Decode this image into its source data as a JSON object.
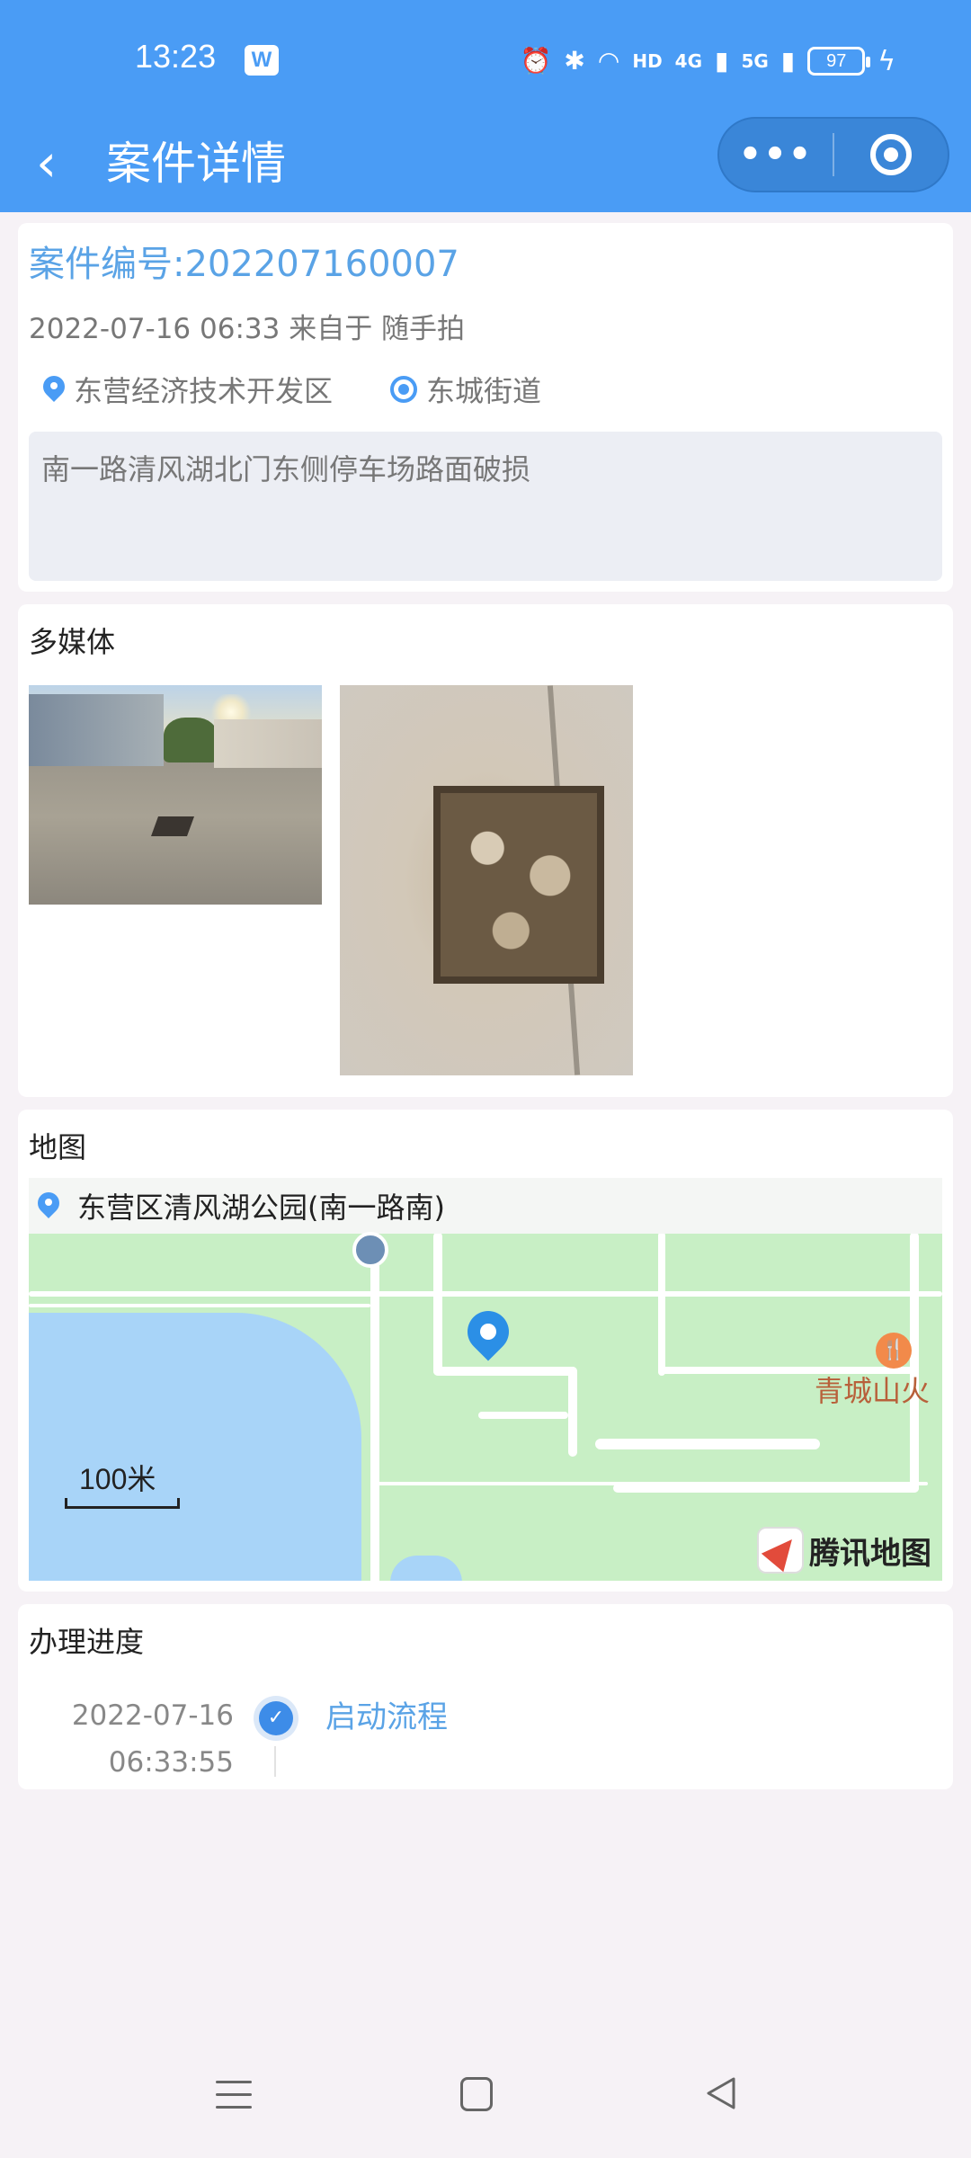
{
  "status_bar": {
    "time": "13:23",
    "app_badge": "W",
    "network_hd": "HD",
    "network_4g": "4G",
    "network_5g": "5G",
    "battery": "97"
  },
  "nav": {
    "back_icon": "chevron-left-icon",
    "title": "案件详情",
    "more_label": "•••",
    "close_icon": "target-icon"
  },
  "case": {
    "number": "案件编号:202207160007",
    "meta": "2022-07-16 06:33 来自于 随手拍",
    "district": "东营经济技术开发区",
    "street": "东城街道",
    "description": "南一路清风湖北门东侧停车场路面破损"
  },
  "media": {
    "title": "多媒体"
  },
  "map": {
    "title": "地图",
    "address": "东营区清风湖公园(南一路南)",
    "scale": "100米",
    "poi_label": "青城山火",
    "brand": "腾讯地图"
  },
  "progress": {
    "title": "办理进度",
    "items": [
      {
        "date": "2022-07-16",
        "time": "06:33:55",
        "label": "启动流程"
      }
    ]
  },
  "colors": {
    "primary": "#4a9cf5",
    "accent_text": "#5aa3e6",
    "background": "#f6f2f6"
  }
}
